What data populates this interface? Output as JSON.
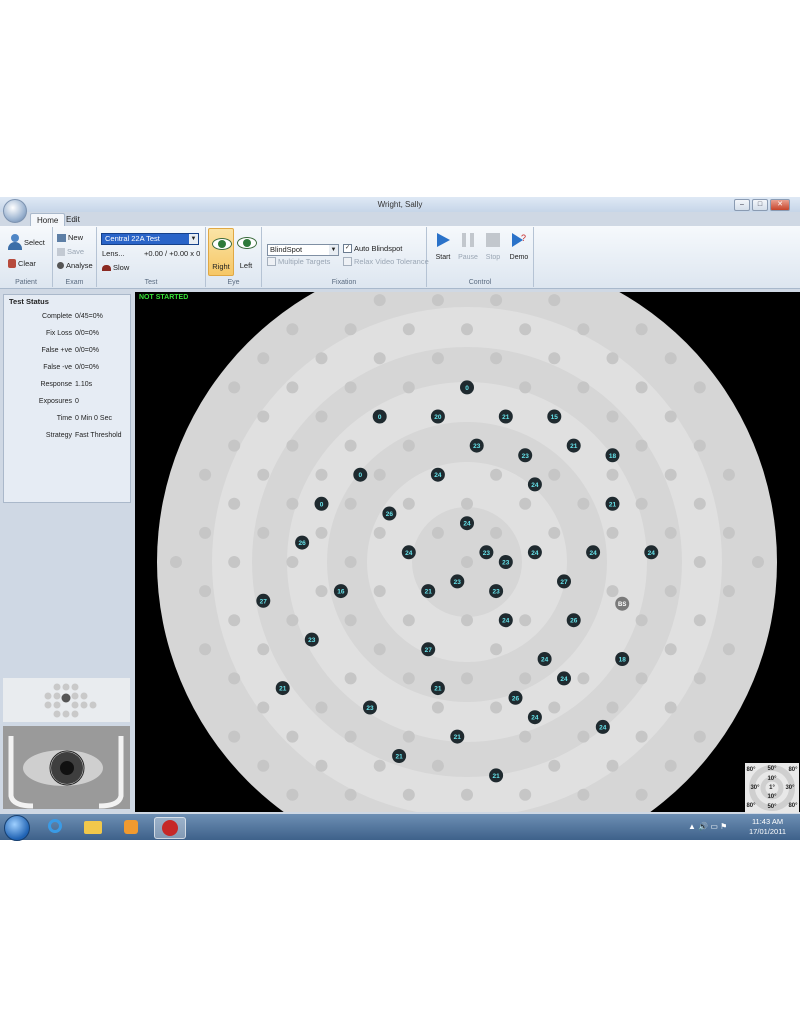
{
  "window": {
    "title": "Wright, Sally"
  },
  "tabs": [
    {
      "label": "Home"
    },
    {
      "label": "Edit"
    }
  ],
  "ribbon": {
    "patient": {
      "caption": "Patient",
      "select": "Select",
      "clear": "Clear"
    },
    "exam": {
      "caption": "Exam",
      "new": "New",
      "save": "Save",
      "analyse": "Analyse"
    },
    "test": {
      "caption": "Test",
      "selected": "Central 22A Test",
      "lens_label": "Lens...",
      "lens_value": "+0.00 / +0.00 x 0",
      "speed": "Slow"
    },
    "eye": {
      "caption": "Eye",
      "right": "Right",
      "left": "Left"
    },
    "fixation": {
      "caption": "Fixation",
      "selected": "BlindSpot",
      "auto_blindspot": "Auto Blindspot",
      "auto_blindspot_checked": true,
      "multiple_targets": "Multiple Targets",
      "relax_video": "Relax Video Tolerance"
    },
    "control": {
      "caption": "Control",
      "start": "Start",
      "pause": "Pause",
      "stop": "Stop",
      "demo": "Demo"
    }
  },
  "test_status": {
    "title": "Test Status",
    "rows": [
      {
        "label": "Complete",
        "value": "0/45=0%"
      },
      {
        "label": "Fix Loss",
        "value": "0/0=0%"
      },
      {
        "label": "False +ve",
        "value": "0/0=0%"
      },
      {
        "label": "False -ve",
        "value": "0/0=0%"
      },
      {
        "label": "Response",
        "value": "1.10s"
      },
      {
        "label": "Exposures",
        "value": "0"
      },
      {
        "label": "Time",
        "value": "0 Min 0 Sec"
      },
      {
        "label": "Strategy",
        "value": "Fast Threshold"
      }
    ]
  },
  "field": {
    "status": "NOT STARTED",
    "blindspot_label": "BS",
    "points": [
      {
        "x": 0,
        "y": -18,
        "v": "0"
      },
      {
        "x": 9,
        "y": -15,
        "v": "15"
      },
      {
        "x": -9,
        "y": -15,
        "v": "0"
      },
      {
        "x": -3,
        "y": -15,
        "v": "20"
      },
      {
        "x": 4,
        "y": -15,
        "v": "21"
      },
      {
        "x": 15,
        "y": -11,
        "v": "18"
      },
      {
        "x": 11,
        "y": -12,
        "v": "21"
      },
      {
        "x": 1,
        "y": -12,
        "v": "23"
      },
      {
        "x": 6,
        "y": -11,
        "v": "23"
      },
      {
        "x": -11,
        "y": -9,
        "v": "0"
      },
      {
        "x": -3,
        "y": -9,
        "v": "24"
      },
      {
        "x": 7,
        "y": -8,
        "v": "24"
      },
      {
        "x": -15,
        "y": -6,
        "v": "0"
      },
      {
        "x": 15,
        "y": -6,
        "v": "21"
      },
      {
        "x": -8,
        "y": -5,
        "v": "26"
      },
      {
        "x": 0,
        "y": -4,
        "v": "24"
      },
      {
        "x": 19,
        "y": -1,
        "v": "24"
      },
      {
        "x": 13,
        "y": -1,
        "v": "24"
      },
      {
        "x": -17,
        "y": -2,
        "v": "26"
      },
      {
        "x": 2,
        "y": -1,
        "v": "23"
      },
      {
        "x": 7,
        "y": -1,
        "v": "24"
      },
      {
        "x": -6,
        "y": -1,
        "v": "24"
      },
      {
        "x": 4,
        "y": 0,
        "v": "23"
      },
      {
        "x": -1,
        "y": 2,
        "v": "23"
      },
      {
        "x": 3,
        "y": 3,
        "v": "23"
      },
      {
        "x": -4,
        "y": 3,
        "v": "21"
      },
      {
        "x": -13,
        "y": 3,
        "v": "16"
      },
      {
        "x": 10,
        "y": 2,
        "v": "27"
      },
      {
        "x": -21,
        "y": 4,
        "v": "27"
      },
      {
        "x": 4,
        "y": 6,
        "v": "24"
      },
      {
        "x": 11,
        "y": 6,
        "v": "26"
      },
      {
        "x": -16,
        "y": 8,
        "v": "23"
      },
      {
        "x": -4,
        "y": 9,
        "v": "27"
      },
      {
        "x": 8,
        "y": 10,
        "v": "24"
      },
      {
        "x": 16,
        "y": 10,
        "v": "18"
      },
      {
        "x": 10,
        "y": 12,
        "v": "24"
      },
      {
        "x": -19,
        "y": 13,
        "v": "21"
      },
      {
        "x": -3,
        "y": 13,
        "v": "21"
      },
      {
        "x": 5,
        "y": 14,
        "v": "26"
      },
      {
        "x": -10,
        "y": 15,
        "v": "23"
      },
      {
        "x": 7,
        "y": 16,
        "v": "24"
      },
      {
        "x": 14,
        "y": 17,
        "v": "24"
      },
      {
        "x": -1,
        "y": 18,
        "v": "21"
      },
      {
        "x": -7,
        "y": 20,
        "v": "21"
      },
      {
        "x": 3,
        "y": 22,
        "v": "21"
      }
    ]
  },
  "scale_legend": [
    "80°",
    "50°",
    "80°",
    "10°",
    "30°",
    "1°",
    "30°",
    "10°",
    "80°",
    "50°",
    "80°"
  ],
  "taskbar": {
    "time": "11:43 AM",
    "date": "17/01/2011"
  }
}
